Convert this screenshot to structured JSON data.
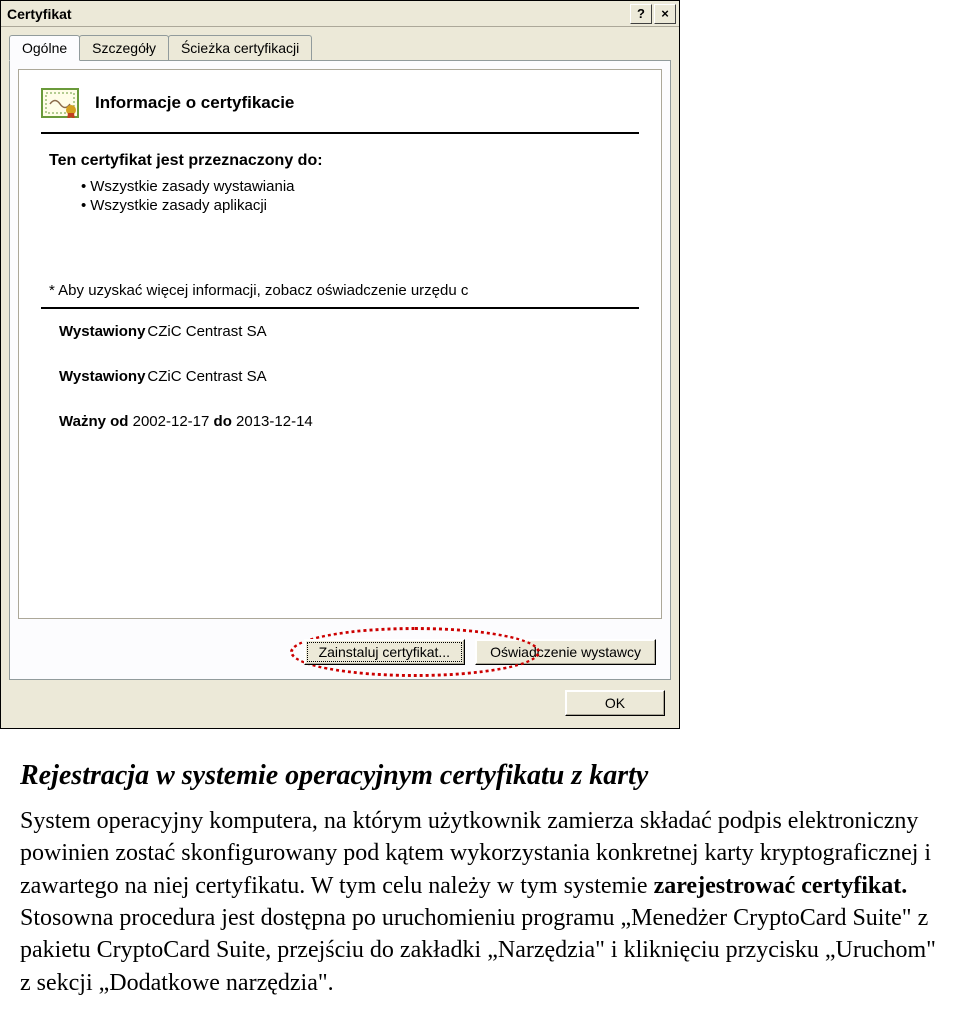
{
  "dialog": {
    "title": "Certyfikat",
    "help_symbol": "?",
    "close_symbol": "×",
    "tabs": [
      "Ogólne",
      "Szczegóły",
      "Ścieżka certyfikacji"
    ],
    "active_tab": 0,
    "cert_info_label": "Informacje o certyfikacie",
    "purpose": {
      "title": "Ten certyfikat jest przeznaczony do:",
      "items": [
        "Wszystkie zasady wystawiania",
        "Wszystkie zasady aplikacji"
      ]
    },
    "note": "* Aby uzyskać więcej informacji, zobacz oświadczenie urzędu c",
    "issued_to": {
      "label": "Wystawiony",
      "value": "CZiC Centrast SA"
    },
    "issued_by": {
      "label": "Wystawiony",
      "value": "CZiC Centrast SA"
    },
    "validity": {
      "label_from": "Ważny od",
      "from": "2002-12-17",
      "label_to": "do",
      "to": "2013-12-14"
    },
    "install_btn": "Zainstaluj certyfikat...",
    "statement_btn": "Oświadczenie wystawcy",
    "ok_btn": "OK"
  },
  "article": {
    "heading": "Rejestracja w systemie operacyjnym certyfikatu z karty",
    "body_parts": [
      "System operacyjny komputera, na którym użytkownik zamierza składać podpis elektroniczny powinien zostać skonfigurowany pod kątem wykorzystania konkretnej karty kryptograficznej i zawartego na niej certyfikatu. W tym celu należy w tym systemie ",
      "zarejestrować certyfikat.",
      " Stosowna procedura jest dostępna po uruchomieniu programu „Menedżer CryptoCard Suite\" z pakietu CryptoCard Suite, przejściu do zakładki „Narzędzia\" i kliknięciu przycisku „Uruchom\" z sekcji „Dodatkowe narzędzia\"."
    ]
  }
}
